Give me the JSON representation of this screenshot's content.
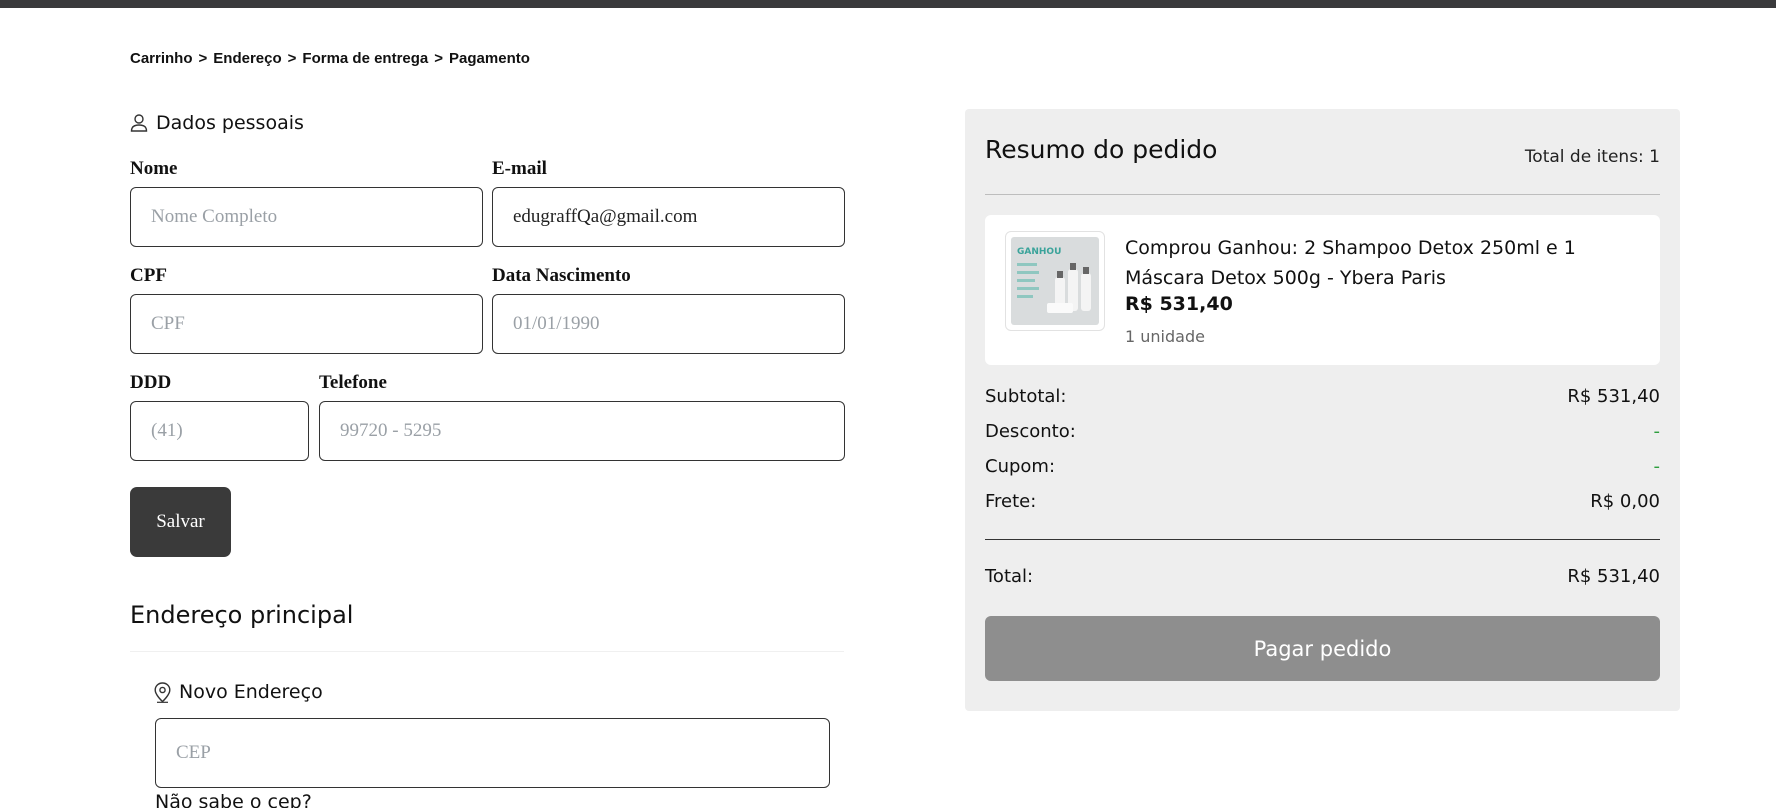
{
  "breadcrumb": {
    "items": [
      "Carrinho",
      "Endereço",
      "Forma de entrega",
      "Pagamento"
    ],
    "separator": ">"
  },
  "personal": {
    "section_title": "Dados pessoais",
    "name_label": "Nome",
    "name_placeholder": "Nome Completo",
    "name_value": "",
    "email_label": "E-mail",
    "email_value": "edugraffQa@gmail.com",
    "cpf_label": "CPF",
    "cpf_placeholder": "CPF",
    "birth_label": "Data Nascimento",
    "birth_placeholder": "01/01/1990",
    "ddd_label": "DDD",
    "ddd_placeholder": "(41)",
    "phone_label": "Telefone",
    "phone_placeholder": "99720 - 5295",
    "save_label": "Salvar"
  },
  "address": {
    "title": "Endereço principal",
    "new_address_label": "Novo Endereço",
    "cep_placeholder": "CEP",
    "no_cep_link": "Não sabe o cep?"
  },
  "summary": {
    "title": "Resumo do pedido",
    "total_items": "Total de itens: 1",
    "item": {
      "image_text": "GANHOU",
      "name": "Comprou Ganhou: 2 Shampoo Detox 250ml e 1 Máscara Detox 500g - Ybera Paris",
      "price": "R$ 531,40",
      "quantity": "1 unidade"
    },
    "subtotal_label": "Subtotal:",
    "subtotal_value": "R$ 531,40",
    "discount_label": "Desconto:",
    "discount_value": "-",
    "coupon_label": "Cupom:",
    "coupon_value": "-",
    "shipping_label": "Frete:",
    "shipping_value": "R$ 0,00",
    "total_label": "Total:",
    "total_value": "R$ 531,40",
    "pay_label": "Pagar pedido"
  },
  "colors": {
    "topbar": "#3a3a3c",
    "save_button": "#3a3a3a",
    "pay_button": "#8e8e8e",
    "summary_bg": "#eeeeee",
    "dash_green": "#2e9e3e"
  }
}
